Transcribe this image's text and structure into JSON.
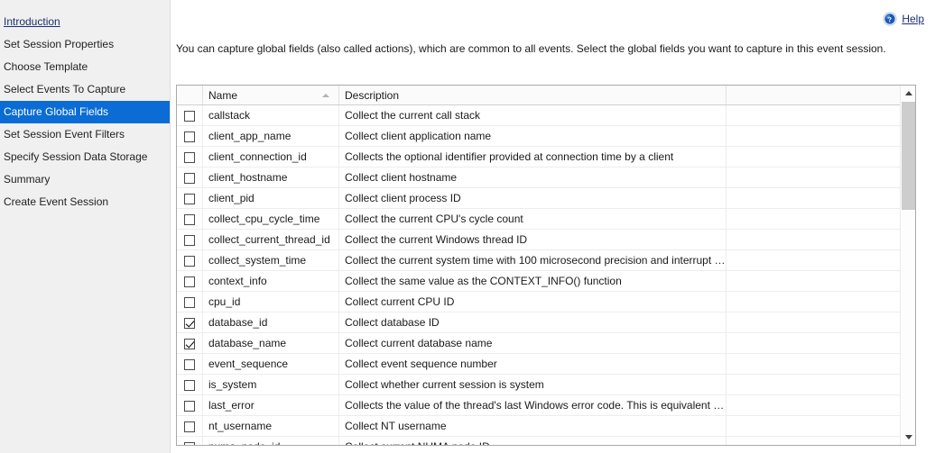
{
  "sidebar": {
    "items": [
      {
        "label": "Introduction",
        "state": "link"
      },
      {
        "label": "Set Session Properties",
        "state": "normal"
      },
      {
        "label": "Choose Template",
        "state": "normal"
      },
      {
        "label": "Select Events To Capture",
        "state": "normal"
      },
      {
        "label": "Capture Global Fields",
        "state": "selected"
      },
      {
        "label": "Set Session Event Filters",
        "state": "normal"
      },
      {
        "label": "Specify Session Data Storage",
        "state": "normal"
      },
      {
        "label": "Summary",
        "state": "normal"
      },
      {
        "label": "Create Event Session",
        "state": "normal"
      }
    ]
  },
  "header": {
    "help_label": "Help",
    "help_icon": "help-circle-icon"
  },
  "main": {
    "instruction": "You can capture global fields (also called actions), which are common to all events. Select the global fields you want to capture in this event session.",
    "grid": {
      "columns": [
        "",
        "Name",
        "Description",
        ""
      ],
      "sort_column": "Name",
      "sort_direction": "ascending",
      "rows": [
        {
          "checked": false,
          "name": "callstack",
          "description": "Collect the current call stack"
        },
        {
          "checked": false,
          "name": "client_app_name",
          "description": "Collect client application name"
        },
        {
          "checked": false,
          "name": "client_connection_id",
          "description": "Collects the optional identifier provided at connection time by a client"
        },
        {
          "checked": false,
          "name": "client_hostname",
          "description": "Collect client hostname"
        },
        {
          "checked": false,
          "name": "client_pid",
          "description": "Collect client process ID"
        },
        {
          "checked": false,
          "name": "collect_cpu_cycle_time",
          "description": "Collect the current CPU's cycle count"
        },
        {
          "checked": false,
          "name": "collect_current_thread_id",
          "description": "Collect the current Windows thread ID"
        },
        {
          "checked": false,
          "name": "collect_system_time",
          "description": "Collect the current system time with 100 microsecond precision and interrupt tick resolut..."
        },
        {
          "checked": false,
          "name": "context_info",
          "description": "Collect the same value as the CONTEXT_INFO() function"
        },
        {
          "checked": false,
          "name": "cpu_id",
          "description": "Collect current CPU ID"
        },
        {
          "checked": true,
          "name": "database_id",
          "description": "Collect database ID"
        },
        {
          "checked": true,
          "name": "database_name",
          "description": "Collect current database name"
        },
        {
          "checked": false,
          "name": "event_sequence",
          "description": "Collect event sequence number"
        },
        {
          "checked": false,
          "name": "is_system",
          "description": "Collect whether current session is system"
        },
        {
          "checked": false,
          "name": "last_error",
          "description": "Collects the value of the thread's last Windows error code. This is equivalent to the Get..."
        },
        {
          "checked": false,
          "name": "nt_username",
          "description": "Collect NT username"
        },
        {
          "checked": false,
          "name": "numa_node_id",
          "description": "Collect current NUMA node ID"
        }
      ]
    },
    "scrollbar": {
      "up_icon": "chevron-up-icon",
      "down_icon": "chevron-down-icon"
    }
  },
  "colors": {
    "selection": "#0a6cd4",
    "link": "#1b2f6e",
    "sidebar_bg": "#f0f0f0"
  }
}
